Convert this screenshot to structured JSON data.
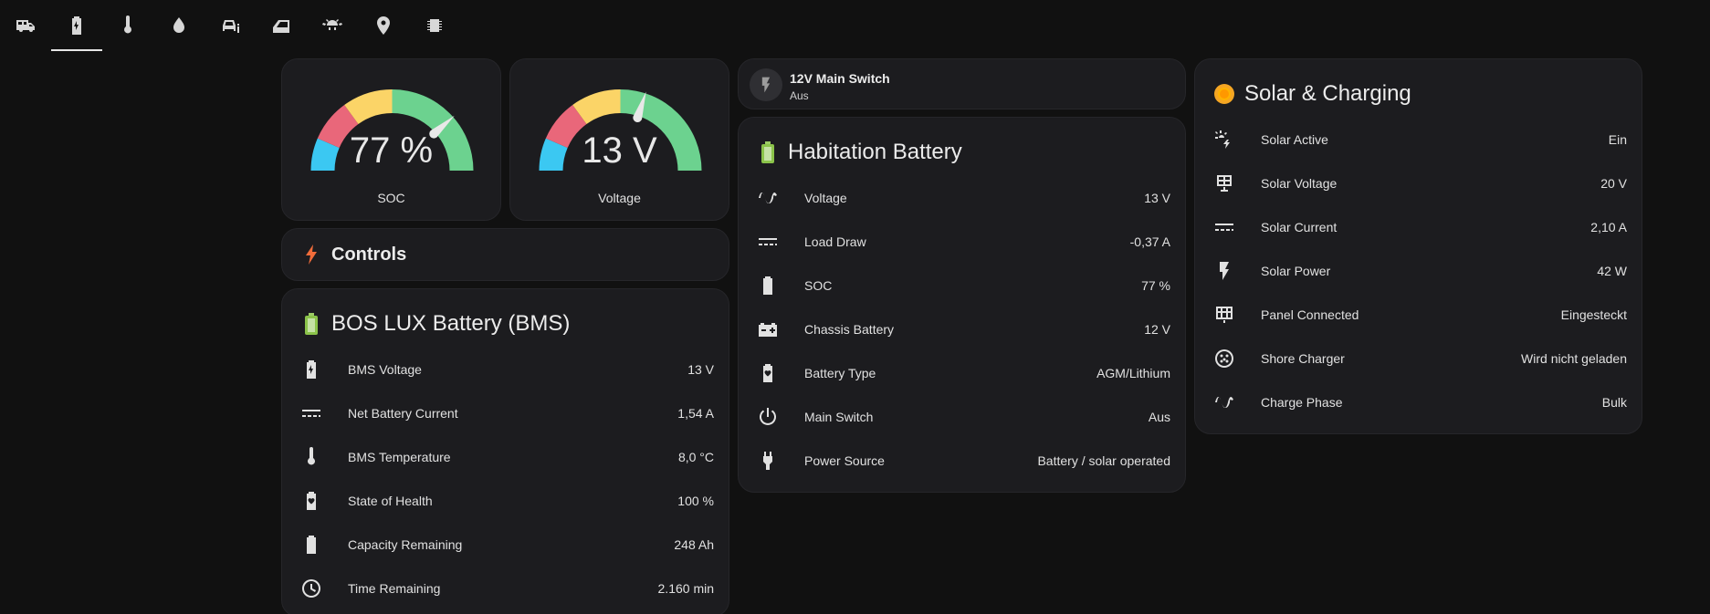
{
  "nav": {
    "tabs": [
      {
        "icon": "rv-truck-icon",
        "active": false
      },
      {
        "icon": "battery-charging-icon",
        "active": true
      },
      {
        "icon": "thermometer-icon",
        "active": false
      },
      {
        "icon": "water-icon",
        "active": false
      },
      {
        "icon": "car-info-icon",
        "active": false
      },
      {
        "icon": "car-door-icon",
        "active": false
      },
      {
        "icon": "car-light-icon",
        "active": false
      },
      {
        "icon": "map-marker-icon",
        "active": false
      },
      {
        "icon": "chip-icon",
        "active": false
      }
    ]
  },
  "gauges": {
    "soc": {
      "value": "77 %",
      "name": "SOC",
      "level": 77,
      "min": 0,
      "max": 100
    },
    "voltage": {
      "value": "13 V",
      "name": "Voltage",
      "level": 13,
      "min": 10,
      "max": 15
    }
  },
  "colors": {
    "red": "#e9677a",
    "yellow": "#fbd467",
    "green": "#6cd28f",
    "blue": "#3bc8f2",
    "accent": "#f16c3a"
  },
  "tile": {
    "title": "12V Main Switch",
    "state": "Aus",
    "icon": "flash-icon"
  },
  "controls": {
    "title": "Controls",
    "icon": "lightning-icon"
  },
  "bms": {
    "title": "BOS LUX Battery (BMS)",
    "rows": [
      {
        "icon": "battery-charging-icon",
        "name": "BMS Voltage",
        "value": "13 V"
      },
      {
        "icon": "current-dc-icon",
        "name": "Net Battery Current",
        "value": "1,54 A"
      },
      {
        "icon": "thermometer-icon",
        "name": "BMS Temperature",
        "value": "8,0 °C"
      },
      {
        "icon": "battery-heart-icon",
        "name": "State of Health",
        "value": "100 %"
      },
      {
        "icon": "battery-icon",
        "name": "Capacity Remaining",
        "value": "248 Ah"
      },
      {
        "icon": "clock-icon",
        "name": "Time Remaining",
        "value": "2.160 min"
      }
    ]
  },
  "habitation": {
    "title": "Habitation Battery",
    "rows": [
      {
        "icon": "sine-wave-icon",
        "name": "Voltage",
        "value": "13 V"
      },
      {
        "icon": "current-dc-icon",
        "name": "Load Draw",
        "value": "-0,37 A"
      },
      {
        "icon": "battery-icon",
        "name": "SOC",
        "value": "77 %"
      },
      {
        "icon": "car-battery-icon",
        "name": "Chassis Battery",
        "value": "12 V"
      },
      {
        "icon": "battery-heart-icon",
        "name": "Battery Type",
        "value": "AGM/Lithium"
      },
      {
        "icon": "power-icon",
        "name": "Main Switch",
        "value": "Aus"
      },
      {
        "icon": "power-plug-icon",
        "name": "Power Source",
        "value": "Battery / solar operated"
      }
    ]
  },
  "solar": {
    "title": "Solar & Charging",
    "rows": [
      {
        "icon": "solar-power-icon",
        "name": "Solar Active",
        "value": "Ein"
      },
      {
        "icon": "solar-panel-icon",
        "name": "Solar Voltage",
        "value": "20 V"
      },
      {
        "icon": "current-dc-icon",
        "name": "Solar Current",
        "value": "2,10 A"
      },
      {
        "icon": "flash-icon",
        "name": "Solar Power",
        "value": "42 W"
      },
      {
        "icon": "solar-panel-large-icon",
        "name": "Panel Connected",
        "value": "Eingesteckt"
      },
      {
        "icon": "ev-plug-icon",
        "name": "Shore Charger",
        "value": "Wird nicht geladen"
      },
      {
        "icon": "sine-wave-icon",
        "name": "Charge Phase",
        "value": "Bulk"
      }
    ]
  }
}
